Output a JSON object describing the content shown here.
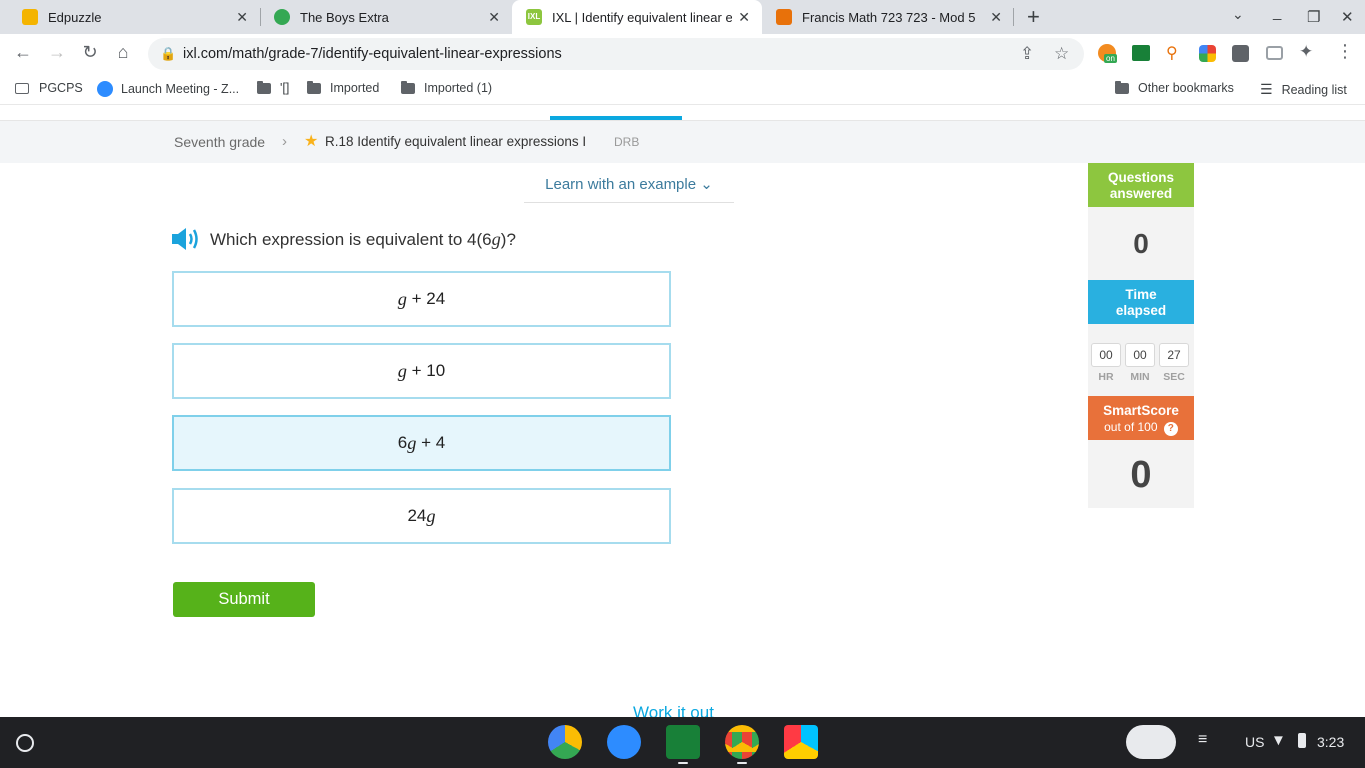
{
  "browser": {
    "tabs": [
      {
        "title": "Edpuzzle",
        "favicon_color": "#f4b400"
      },
      {
        "title": "The Boys Extra",
        "favicon_color": "#34a853"
      },
      {
        "title": "IXL | Identify equivalent linear ex",
        "favicon_color": "#8dc63f"
      },
      {
        "title": "Francis Math 723 723 - Mod 5",
        "favicon_color": "#e8710a"
      }
    ],
    "url": "ixl.com/math/grade-7/identify-equivalent-linear-expressions",
    "bookmarks": [
      "PGCPS",
      "Launch Meeting - Z...",
      "'[]",
      "Imported",
      "Imported (1)"
    ],
    "other_bookmarks": "Other bookmarks",
    "reading_list": "Reading list",
    "ext_badge": "on"
  },
  "page": {
    "breadcrumb": {
      "grade": "Seventh grade",
      "skill": "R.18 Identify equivalent linear expressions I",
      "code": "DRB"
    },
    "learn_link": "Learn with an example",
    "question": {
      "prefix": "Which expression is equivalent to 4(6",
      "var": "g",
      "suffix": ")?"
    },
    "choices": [
      {
        "pre": "",
        "var": "g",
        "post": " + 24",
        "selected": false
      },
      {
        "pre": "",
        "var": "g",
        "post": " + 10",
        "selected": false
      },
      {
        "pre": "6",
        "var": "g",
        "post": " + 4",
        "selected": true
      },
      {
        "pre": "24",
        "var": "g",
        "post": "",
        "selected": false
      }
    ],
    "submit": "Submit",
    "work_it_out": "Work it out"
  },
  "sidebar": {
    "questions_label_1": "Questions",
    "questions_label_2": "answered",
    "questions_value": "0",
    "time_label_1": "Time",
    "time_label_2": "elapsed",
    "time": {
      "hr": "00",
      "min": "00",
      "sec": "27"
    },
    "time_units": {
      "hr": "HR",
      "min": "MIN",
      "sec": "SEC"
    },
    "smartscore_label": "SmartScore",
    "smartscore_sub": "out of 100",
    "smartscore_value": "0",
    "colors": {
      "questions": "#8dc63f",
      "time": "#29b0e0",
      "smartscore": "#e8713a"
    }
  },
  "shelf": {
    "ime": "US",
    "clock": "3:23"
  }
}
